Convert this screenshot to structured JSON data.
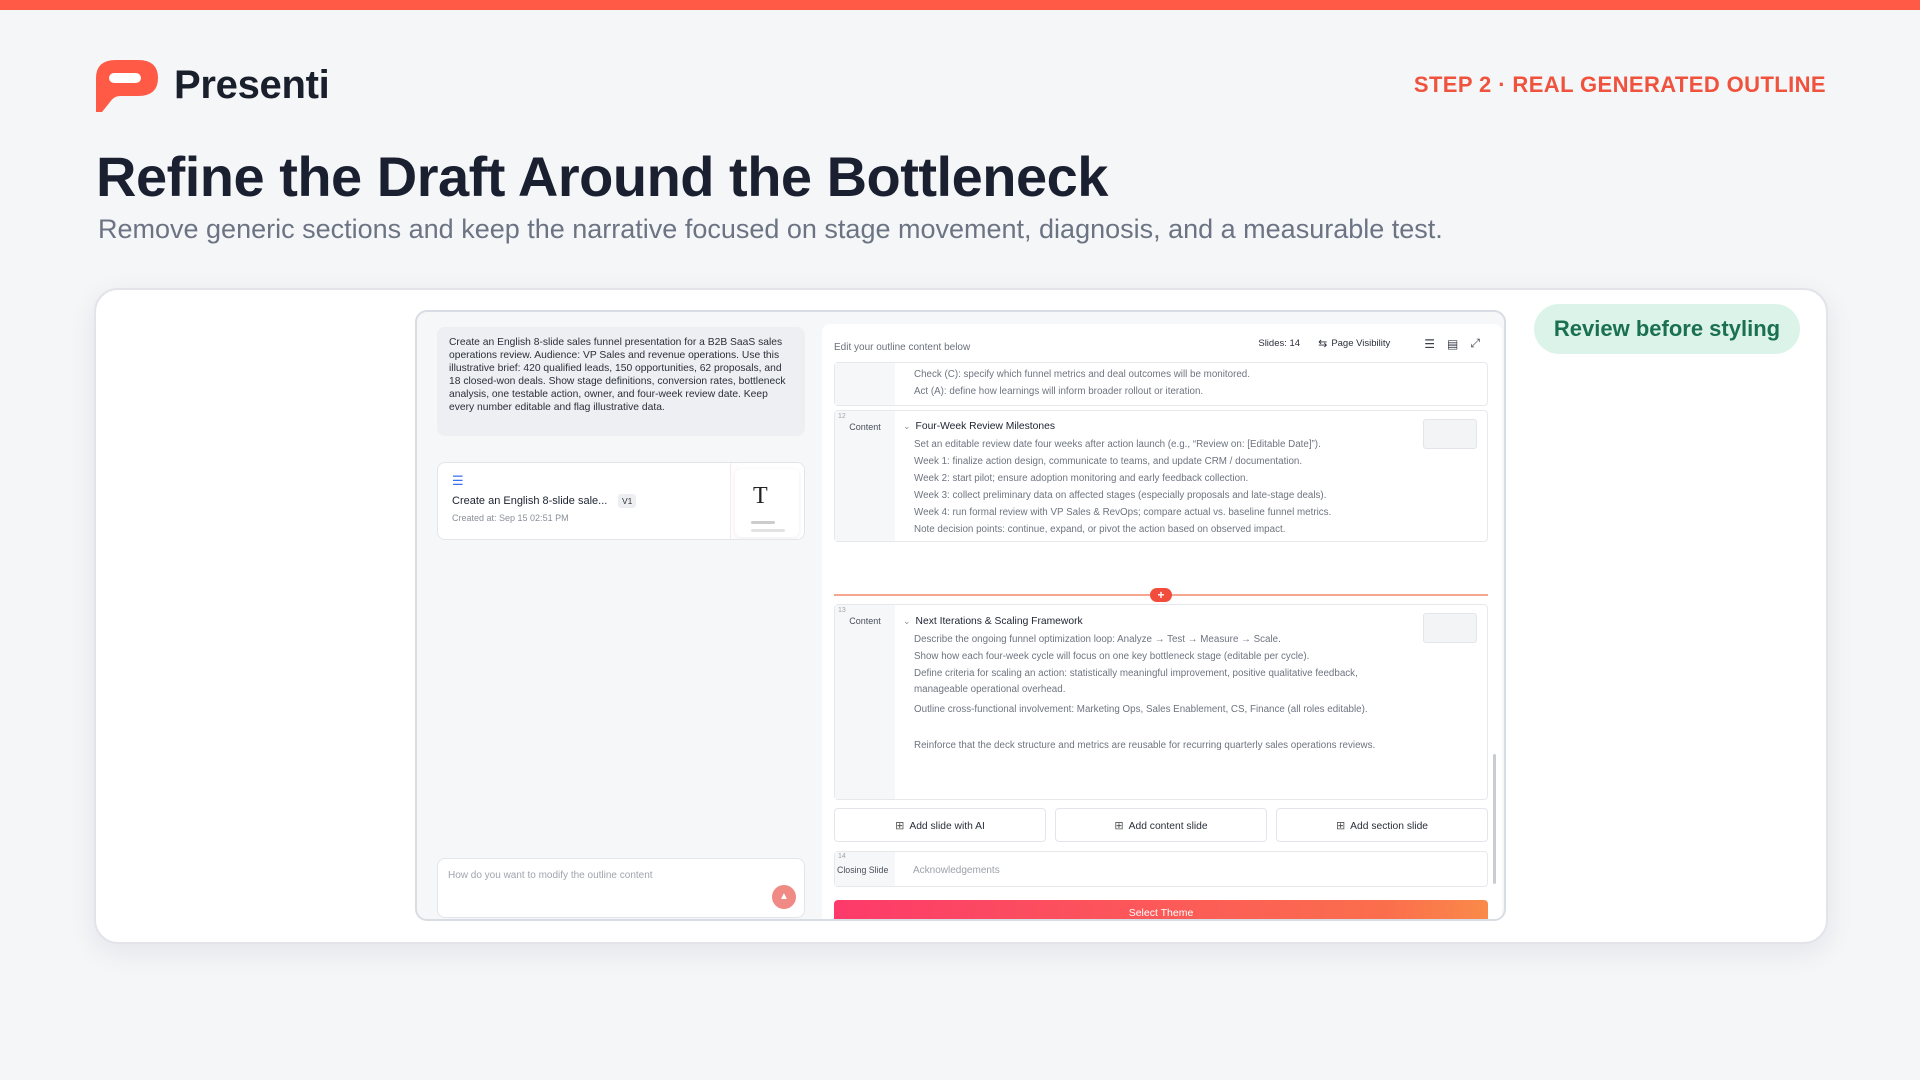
{
  "brand": {
    "name": "Presenti",
    "accent": "#ff5a46"
  },
  "step_label": "STEP 2 · REAL GENERATED OUTLINE",
  "title": "Refine the Draft Around the Bottleneck",
  "subtitle": "Remove generic sections and keep the narrative focused on stage movement, diagnosis, and a measurable test.",
  "review_pill": "Review before styling",
  "left_panel": {
    "prompt": "Create an English 8-slide sales funnel presentation for a B2B SaaS sales operations review. Audience: VP Sales and revenue operations. Use this illustrative brief: 420 qualified leads, 150 opportunities, 62 proposals, and 18 closed-won deals. Show stage definitions, conversion rates, bottleneck analysis, one testable action, owner, and four-week review date. Keep every number editable and flag illustrative data.",
    "version": {
      "title": "Create an English 8-slide sale...",
      "badge": "V1",
      "created": "Created at: Sep 15 02:51 PM"
    },
    "modify_placeholder": "How do you want to modify the outline content"
  },
  "outline": {
    "header": "Edit your outline content below",
    "slides_count": "Slides: 14",
    "page_visibility": "Page Visibility",
    "prev_bullets": [
      "Check (C): specify which funnel metrics and deal outcomes will be monitored.",
      "Act (A): define how learnings will inform broader rollout or iteration."
    ],
    "slide12": {
      "num": "12",
      "type": "Content",
      "title": "Four-Week Review Milestones",
      "bullets": [
        "Set an editable review date four weeks after action launch (e.g., “Review on: [Editable Date]”).",
        "Week 1: finalize action design, communicate to teams, and update CRM / documentation.",
        "Week 2: start pilot; ensure adoption monitoring and early feedback collection.",
        "Week 3: collect preliminary data on affected stages (especially proposals and late-stage deals).",
        "Week 4: run formal review with VP Sales & RevOps; compare actual vs. baseline funnel metrics.",
        "Note decision points: continue, expand, or pivot the action based on observed impact."
      ]
    },
    "slide13": {
      "num": "13",
      "type": "Content",
      "title": "Next Iterations & Scaling Framework",
      "bullets": [
        "Describe the ongoing funnel optimization loop: Analyze → Test → Measure → Scale.",
        "Show how each four-week cycle will focus on one key bottleneck stage (editable per cycle).",
        "Define criteria for scaling an action: statistically meaningful improvement, positive qualitative feedback, manageable operational overhead.",
        "Outline cross-functional involvement: Marketing Ops, Sales Enablement, CS, Finance (all roles editable).",
        "Reinforce that the deck structure and metrics are reusable for recurring quarterly sales operations reviews."
      ]
    },
    "actions": {
      "add_ai": "Add slide with AI",
      "add_content": "Add content slide",
      "add_section": "Add section slide"
    },
    "closing": {
      "num": "14",
      "type": "Closing Slide",
      "text": "Acknowledgements"
    },
    "select_theme": "Select Theme"
  }
}
